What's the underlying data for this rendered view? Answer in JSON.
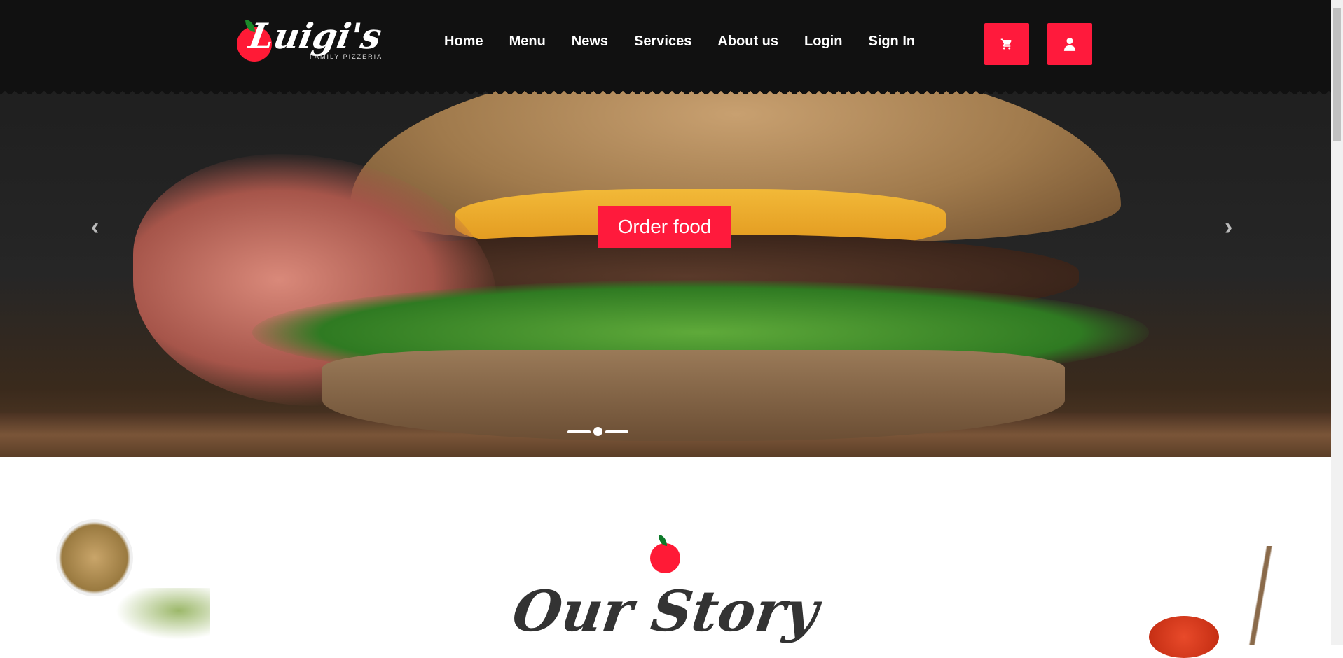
{
  "brand": {
    "name": "Luigi's",
    "tagline": "FAMILY PIZZERIA"
  },
  "nav": [
    "Home",
    "Menu",
    "News",
    "Services",
    "About us",
    "Login",
    "Sign In"
  ],
  "header_buttons": {
    "cart": "cart-icon",
    "user": "user-icon"
  },
  "hero": {
    "cta": "Order food",
    "prev": "‹",
    "next": "›",
    "slides": 3,
    "active_slide": 2
  },
  "story": {
    "title": "Our Story"
  },
  "colors": {
    "accent": "#ff1a3c",
    "header": "#111111"
  }
}
